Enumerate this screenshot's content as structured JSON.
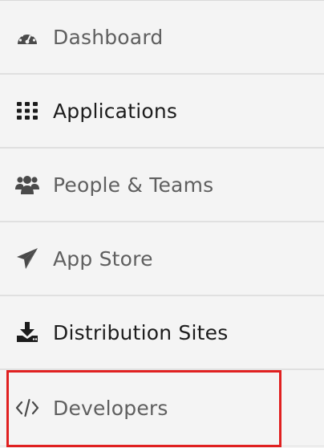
{
  "nav": {
    "items": [
      {
        "label": "Dashboard",
        "icon": "dashboard-icon"
      },
      {
        "label": "Applications",
        "icon": "grid-icon"
      },
      {
        "label": "People & Teams",
        "icon": "users-icon"
      },
      {
        "label": "App Store",
        "icon": "paper-plane-icon"
      },
      {
        "label": "Distribution Sites",
        "icon": "download-icon"
      },
      {
        "label": "Developers",
        "icon": "code-icon"
      }
    ]
  },
  "colors": {
    "background": "#f4f4f4",
    "divider": "#e0e0e0",
    "text_dim": "#5f5f5f",
    "text_dark": "#1c1c1c",
    "highlight": "#e02020"
  }
}
